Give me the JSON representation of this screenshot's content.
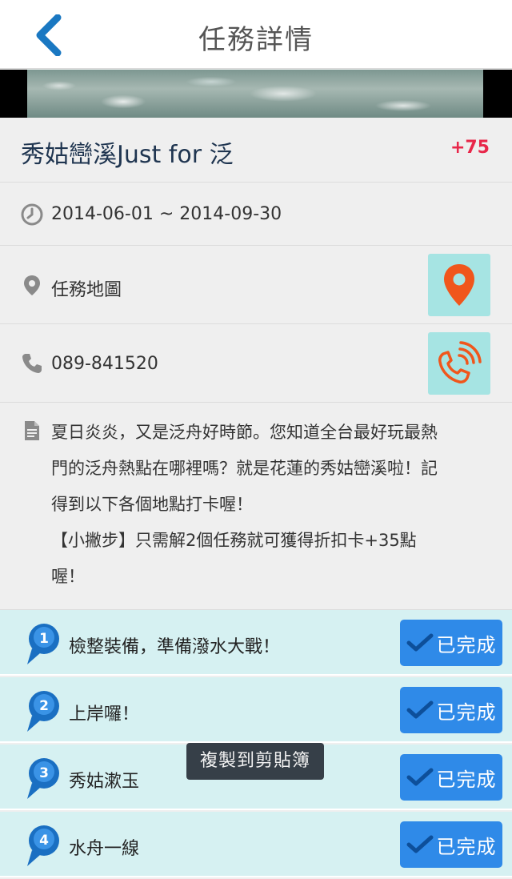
{
  "header": {
    "title": "任務詳情"
  },
  "mission": {
    "title": "秀姑巒溪Just for 泛",
    "points": "+75",
    "date_range": "2014-06-01 ~ 2014-09-30",
    "map_label": "任務地圖",
    "phone": "089-841520",
    "description_lines": [
      "夏日炎炎，又是泛舟好時節。您知道全台最好玩最熱",
      "門的泛舟熱點在哪裡嗎？就是花蓮的秀姑巒溪啦！記",
      "得到以下各個地點打卡喔！",
      "【小撇步】只需解2個任務就可獲得折扣卡+35點",
      "喔！"
    ]
  },
  "tasks": [
    {
      "number": "1",
      "label": "檢整裝備，準備潑水大戰！",
      "status": "已完成"
    },
    {
      "number": "2",
      "label": "上岸囉！",
      "status": "已完成"
    },
    {
      "number": "3",
      "label": "秀姑漱玉",
      "status": "已完成"
    },
    {
      "number": "4",
      "label": "水舟一線",
      "status": "已完成"
    }
  ],
  "toast": {
    "text": "複製到剪貼簿"
  },
  "icons": {
    "back": "chevron-left-icon",
    "clock": "clock-icon",
    "location": "location-pin-icon",
    "phone": "phone-icon",
    "document": "document-icon",
    "map_button": "map-pin-icon",
    "call_button": "phone-call-icon",
    "done_check": "checkmark-icon"
  },
  "colors": {
    "accent_blue": "#2f8ae8",
    "points_red": "#e8274a",
    "button_teal": "#a6e4e3",
    "task_bg": "#d6f1f2",
    "back_arrow": "#1a78c2",
    "icon_orange": "#f0561c"
  }
}
